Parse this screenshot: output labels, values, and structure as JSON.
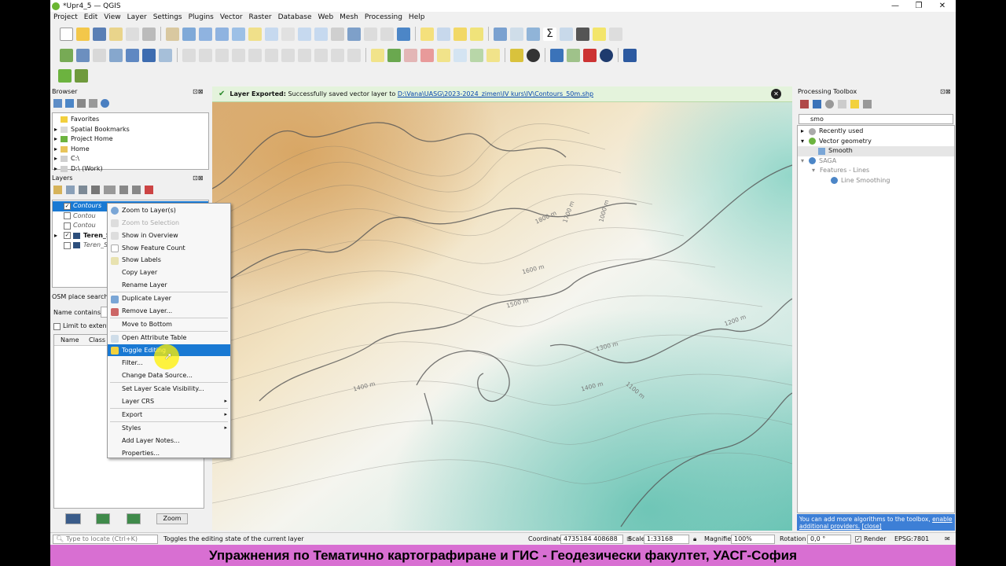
{
  "window": {
    "title": "*Upr4_5 — QGIS",
    "min": "—",
    "max": "❐",
    "close": "✕"
  },
  "menu": [
    "Project",
    "Edit",
    "View",
    "Layer",
    "Settings",
    "Plugins",
    "Vector",
    "Raster",
    "Database",
    "Web",
    "Mesh",
    "Processing",
    "Help"
  ],
  "browser": {
    "title": "Browser",
    "items": [
      "Favorites",
      "Spatial Bookmarks",
      "Project Home",
      "Home",
      "C:\\",
      "D:\\ (Work)"
    ]
  },
  "layers": {
    "title": "Layers",
    "items": [
      "Contours",
      "Contou",
      "Contou",
      "Teren_S",
      "Teren_S"
    ]
  },
  "osm": {
    "title": "OSM place search...",
    "name_label": "Name contains...",
    "limit_label": "Limit to extent",
    "col_name": "Name",
    "col_class": "Class",
    "zoom_btn": "Zoom"
  },
  "message": {
    "title": "Layer Exported:",
    "text": "Successfully saved vector layer to",
    "path": "D:\\Vana\\UASG\\2023-2024_zimen\\IV kurs\\IV\\Contours_50m.shp",
    "close": "✕"
  },
  "context_menu": {
    "items": [
      "Zoom to Layer(s)",
      "Zoom to Selection",
      "Show in Overview",
      "Show Feature Count",
      "Show Labels",
      "Copy Layer",
      "Rename Layer",
      "Duplicate Layer",
      "Remove Layer...",
      "Move to Bottom",
      "Open Attribute Table",
      "Toggle Editing",
      "Filter...",
      "Change Data Source...",
      "Set Layer Scale Visibility...",
      "Layer CRS",
      "Export",
      "Styles",
      "Add Layer Notes...",
      "Properties..."
    ],
    "selected": "Toggle Editing"
  },
  "map_labels": [
    "1800 m",
    "1700 m",
    "1600 m",
    "1500 m",
    "1300 m",
    "1400 m",
    "1400 m",
    "1100 m",
    "1200 m",
    "1000 m"
  ],
  "processing": {
    "title": "Processing Toolbox",
    "search": "smo",
    "items": [
      "Recently used",
      "Vector geometry",
      "Smooth",
      "SAGA",
      "Features - Lines",
      "Line Smoothing"
    ],
    "footer": "You can add more algorithms to the toolbox,",
    "footer_link": "enable additional providers.",
    "footer_close": "[close]"
  },
  "status": {
    "locate_placeholder": "Type to locate (Ctrl+K)",
    "hint": "Toggles the editing state of the current layer",
    "coord_label": "Coordinate",
    "coord_value": "4735184 408688",
    "scale_label": "Scale",
    "scale_value": "1:33168",
    "magnifier_label": "Magnifier",
    "magnifier_value": "100%",
    "rotation_label": "Rotation",
    "rotation_value": "0,0 °",
    "render_label": "Render",
    "crs": "EPSG:7801"
  },
  "banner": "Упражнения по Тематично картографиране и ГИС - Геодезически факултет, УАСГ-София"
}
